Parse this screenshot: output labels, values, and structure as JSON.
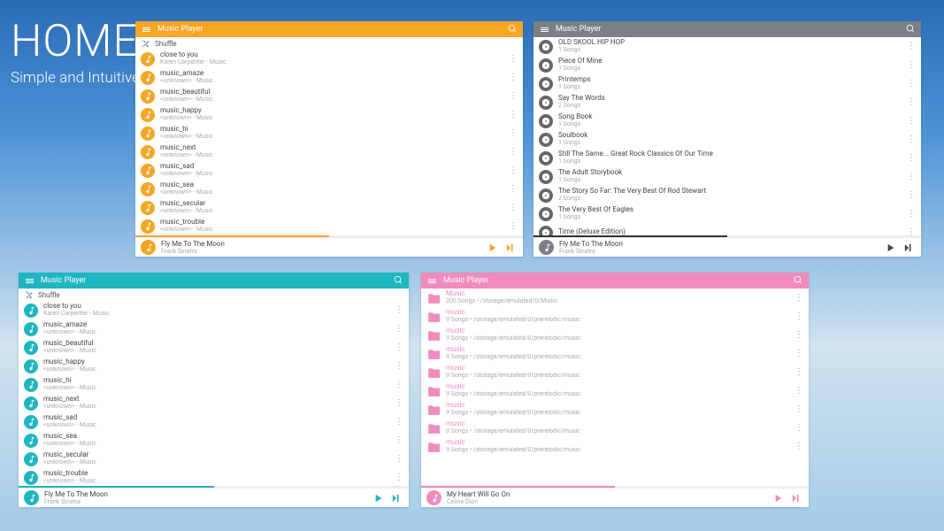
{
  "hero": {
    "title": "HOME",
    "subtitle": "Simple and Intuitive"
  },
  "common": {
    "app_title": "Music Player",
    "shuffle": "Shuffle",
    "unknown_music": "<unknown> - Music"
  },
  "panels": {
    "orange": {
      "rows": [
        {
          "t": "close to you",
          "s": "Karen Carpenter - Music"
        },
        {
          "t": "music_amaze",
          "s": "<unknown> - Music"
        },
        {
          "t": "music_beautiful",
          "s": "<unknown> - Music"
        },
        {
          "t": "music_happy",
          "s": "<unknown> - Music"
        },
        {
          "t": "music_hi",
          "s": "<unknown> - Music"
        },
        {
          "t": "music_next",
          "s": "<unknown> - Music"
        },
        {
          "t": "music_sad",
          "s": "<unknown> - Music"
        },
        {
          "t": "music_sea",
          "s": "<unknown> - Music"
        },
        {
          "t": "music_secular",
          "s": "<unknown> - Music"
        },
        {
          "t": "music_trouble",
          "s": "<unknown> - Music"
        }
      ],
      "now": {
        "t": "Fly Me To The Moon",
        "s": "Frank Sinatra"
      }
    },
    "gray": {
      "rows": [
        {
          "t": "OLD SKOOL HIP HOP",
          "s": "1 Songs"
        },
        {
          "t": "Piece Of Mine",
          "s": "1 Songs"
        },
        {
          "t": "Printemps",
          "s": "1 Songs"
        },
        {
          "t": "Say The Words",
          "s": "2 Songs"
        },
        {
          "t": "Song Book",
          "s": "1 Songs"
        },
        {
          "t": "Soulbook",
          "s": "1 Songs"
        },
        {
          "t": "Still The Same... Great Rock Classics Of Our Time",
          "s": "1 Songs"
        },
        {
          "t": "The Adult Storybook",
          "s": "1 Songs"
        },
        {
          "t": "The Story So Far: The Very Best Of Rod Stewart",
          "s": "2 Songs"
        },
        {
          "t": "The Very Best Of Eagles",
          "s": "1 Songs"
        },
        {
          "t": "Time (Deluxe Edition)",
          "s": ""
        }
      ],
      "now": {
        "t": "Fly Me To The Moon",
        "s": "Frank Sinatra"
      }
    },
    "teal": {
      "rows": [
        {
          "t": "close to you",
          "s": "Karen Carpenter - Music"
        },
        {
          "t": "music_amaze",
          "s": "<unknown> - Music"
        },
        {
          "t": "music_beautiful",
          "s": "<unknown> - Music"
        },
        {
          "t": "music_happy",
          "s": "<unknown> - Music"
        },
        {
          "t": "music_hi",
          "s": "<unknown> - Music"
        },
        {
          "t": "music_next",
          "s": "<unknown> - Music"
        },
        {
          "t": "music_sad",
          "s": "<unknown> - Music"
        },
        {
          "t": "music_sea",
          "s": "<unknown> - Music"
        },
        {
          "t": "music_secular",
          "s": "<unknown> - Music"
        },
        {
          "t": "music_trouble",
          "s": "<unknown> - Music"
        }
      ],
      "now": {
        "t": "Fly Me To The Moon",
        "s": "Frank Sinatra"
      }
    },
    "pink": {
      "rows": [
        {
          "t": "Music",
          "s": "200 Songs  •  /storage/emulated/0/Music"
        },
        {
          "t": "music",
          "s": "9 Songs  •  /storage/emulated/0/prerelodic/music"
        },
        {
          "t": "music",
          "s": "9 Songs  •  /storage/emulated/0/prerelodic/music"
        },
        {
          "t": "music",
          "s": "9 Songs  •  /storage/emulated/0/prerelodic/music"
        },
        {
          "t": "music",
          "s": "9 Songs  •  /storage/emulated/0/prerelodic/music"
        },
        {
          "t": "music",
          "s": "9 Songs  •  /storage/emulated/0/prerelodic/music"
        },
        {
          "t": "music",
          "s": "9 Songs  •  /storage/emulated/0/prerelodic/music"
        },
        {
          "t": "music",
          "s": "9 Songs  •  /storage/emulated/0/prerelodic/music"
        },
        {
          "t": "music",
          "s": "9 Songs  •  /storage/emulated/0/prerelodic/music"
        }
      ],
      "now": {
        "t": "My Heart Will Go On",
        "s": "Celine Dion"
      }
    }
  }
}
